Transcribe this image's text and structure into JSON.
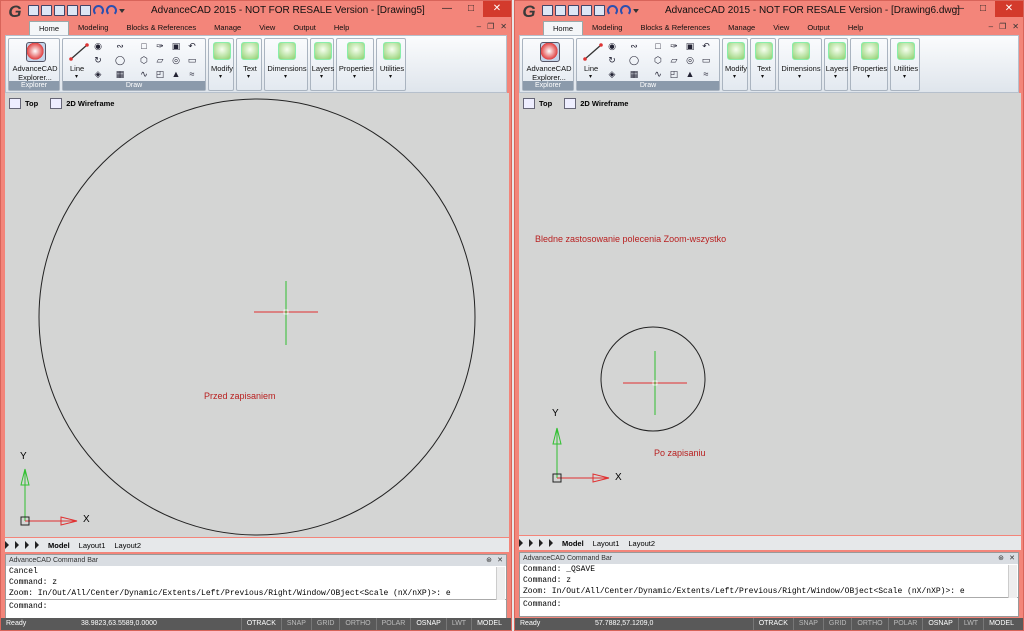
{
  "windows": [
    {
      "title": "AdvanceCAD 2015 - NOT FOR RESALE Version - [Drawing5]",
      "tabs": [
        "Home",
        "Modeling",
        "Blocks & References",
        "Manage",
        "View",
        "Output",
        "Help"
      ],
      "ribbon": {
        "explorer_label": "AdvanceCAD Explorer...",
        "explorer_panel": "Explorer",
        "line_label": "Line",
        "draw_panel": "Draw",
        "panels": [
          "Modify",
          "Text",
          "Dimensions",
          "Layers",
          "Properties",
          "Utilities"
        ]
      },
      "view": {
        "name": "Top",
        "style": "2D Wireframe"
      },
      "annotation": "Przed zapisaniem",
      "ucs": {
        "y": "Y",
        "x": "X"
      },
      "layout_tabs": [
        "Model",
        "Layout1",
        "Layout2"
      ],
      "cmdbar": {
        "title": "AdvanceCAD Command Bar",
        "lines": [
          "Cancel",
          "Command: z",
          "Zoom:  In/Out/All/Center/Dynamic/Extents/Left/Previous/Right/Window/OBject<Scale (nX/nXP)>: e"
        ],
        "prompt": "Command:"
      },
      "status": {
        "ready": "Ready",
        "coords": "38.9823,63.5589,0.0000",
        "toggles": [
          "OTRACK",
          "SNAP",
          "GRID",
          "ORTHO",
          "POLAR",
          "OSNAP",
          "LWT",
          "MODEL"
        ],
        "on": [
          "OTRACK",
          "OSNAP",
          "MODEL"
        ]
      }
    },
    {
      "title": "AdvanceCAD 2015 - NOT FOR RESALE Version - [Drawing6.dwg]",
      "tabs": [
        "Home",
        "Modeling",
        "Blocks & References",
        "Manage",
        "View",
        "Output",
        "Help"
      ],
      "ribbon": {
        "explorer_label": "AdvanceCAD Explorer...",
        "explorer_panel": "Explorer",
        "line_label": "Line",
        "draw_panel": "Draw",
        "panels": [
          "Modify",
          "Text",
          "Dimensions",
          "Layers",
          "Properties",
          "Utilities"
        ]
      },
      "view": {
        "name": "Top",
        "style": "2D Wireframe"
      },
      "annotation_top": "Bledne zastosowanie polecenia Zoom-wszystko",
      "annotation": "Po zapisaniu",
      "ucs": {
        "y": "Y",
        "x": "X"
      },
      "layout_tabs": [
        "Model",
        "Layout1",
        "Layout2"
      ],
      "cmdbar": {
        "title": "AdvanceCAD Command Bar",
        "lines": [
          "Command: _QSAVE",
          "Command: z",
          "Zoom:  In/Out/All/Center/Dynamic/Extents/Left/Previous/Right/Window/OBject<Scale (nX/nXP)>: e"
        ],
        "prompt": "Command:"
      },
      "status": {
        "ready": "Ready",
        "coords": "57.7882,57.1209,0",
        "toggles": [
          "OTRACK",
          "SNAP",
          "GRID",
          "ORTHO",
          "POLAR",
          "OSNAP",
          "LWT",
          "MODEL"
        ],
        "on": [
          "OTRACK",
          "OSNAP",
          "MODEL"
        ]
      }
    }
  ],
  "colors": {
    "title_bg": "#f3857a",
    "canvas_bg": "#d4d5d4",
    "annotation": "#b82020",
    "crosshair_x": "#e03030",
    "crosshair_y": "#30c030"
  }
}
